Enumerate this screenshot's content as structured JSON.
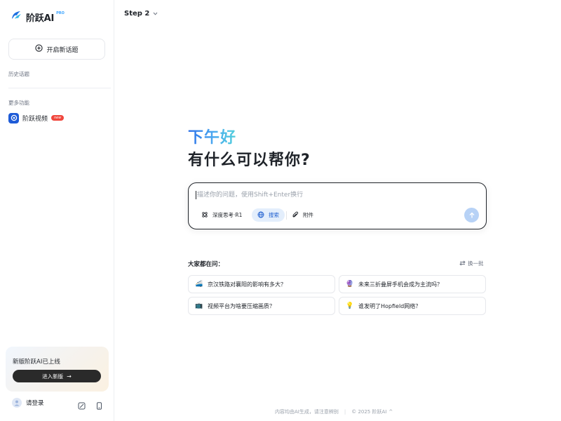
{
  "sidebar": {
    "logo_text": "阶跃AI",
    "logo_badge": "PRO",
    "new_topic_label": "开启新话题",
    "history_label": "历史话题",
    "more_features_label": "更多功能",
    "features": [
      {
        "label": "阶跃视频",
        "badge": "new"
      }
    ],
    "promo": {
      "title": "新版阶跃AI已上线",
      "button_label": "进入新版"
    },
    "login_label": "请登录"
  },
  "header": {
    "title": "Step 2"
  },
  "main": {
    "greeting": "下午好",
    "headline": "有什么可以帮你?",
    "composer": {
      "placeholder": "描述你的问题，使用Shift+Enter换行",
      "value": "",
      "chips": [
        {
          "label": "深度思考·R1",
          "icon": "deep-think-icon"
        },
        {
          "label": "搜索",
          "icon": "globe-icon",
          "active": true
        },
        {
          "label": "附件",
          "icon": "paperclip-icon"
        }
      ]
    },
    "suggestions_title": "大家都在问：",
    "refresh_label": "换一批",
    "suggestions": [
      {
        "emoji": "🚄",
        "text": "京汉铁路对襄阳的影响有多大？"
      },
      {
        "emoji": "🔮",
        "text": "未来三折叠屏手机会成为主流吗？"
      },
      {
        "emoji": "📺",
        "text": "视频平台为啥要压缩画质？"
      },
      {
        "emoji": "💡",
        "text": "谁发明了Hopfield网络？"
      }
    ]
  },
  "footer": {
    "disclaimer": "内容均由AI生成，请注意辨别",
    "copyright": "© 2025 阶跃AI",
    "caret": "^"
  },
  "colors": {
    "accent": "#2b6fe8",
    "search_chip_bg": "#e3eefc",
    "send_button": "#b7d2f6",
    "badge_new": "#f0463c"
  }
}
